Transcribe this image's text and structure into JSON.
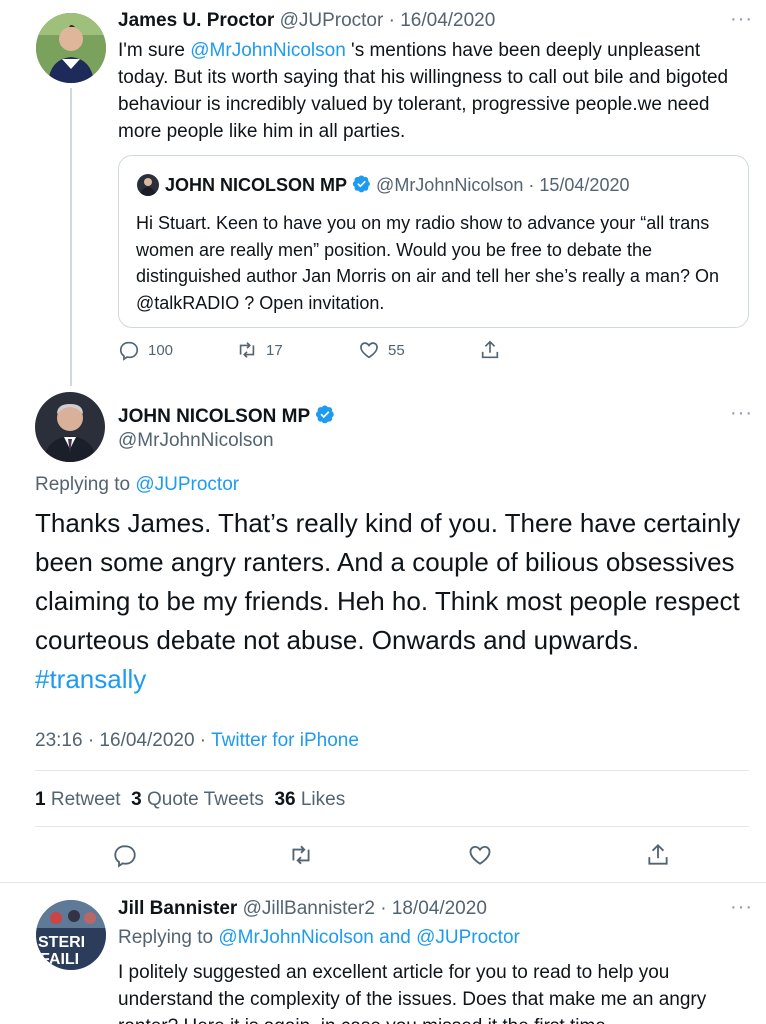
{
  "tweet1": {
    "name": "James U. Proctor",
    "handle": "@JUProctor",
    "date": "· 16/04/2020",
    "more": "···",
    "text_pre": "I'm sure ",
    "mention": "@MrJohnNicolson",
    "text_post": " 's mentions have been deeply unpleasent today. But its worth saying that his willingness to call out bile and bigoted behaviour is incredibly valued by tolerant, progressive people.we need more people like him in all parties.",
    "quote": {
      "name": "JOHN NICOLSON MP",
      "handle": "@MrJohnNicolson",
      "date": "· 15/04/2020",
      "text": "Hi Stuart. Keen to have you on my radio show to advance your “all trans women are really men” position. Would you be free to debate the distinguished author Jan Morris on air and tell her she’s really a man? On @talkRADIO ? Open invitation."
    },
    "replies": "100",
    "retweets": "17",
    "likes": "55"
  },
  "main_tweet": {
    "name": "JOHN NICOLSON MP",
    "handle": "@MrJohnNicolson",
    "more": "···",
    "replying_label": "Replying to ",
    "replying_to": "@JUProctor",
    "text": "Thanks James. That’s really kind of you. There have certainly been some angry ranters. And a couple of bilious obsessives claiming to be my friends. Heh ho. Think most people respect courteous debate not abuse. Onwards and upwards.",
    "hashtag": "#transally",
    "timestamp": "23:16 · 16/04/2020 · ",
    "source": "Twitter for iPhone",
    "stats": {
      "retweets_num": "1",
      "retweets_label": "Retweet",
      "quotes_num": "3",
      "quotes_label": "Quote Tweets",
      "likes_num": "36",
      "likes_label": "Likes"
    }
  },
  "tweet3": {
    "name": "Jill Bannister",
    "handle": "@JillBannister2",
    "date": "· 18/04/2020",
    "more": "···",
    "replying_label": "Replying to ",
    "replying_to": "@MrJohnNicolson and @JUProctor",
    "text": "I politely suggested an excellent article for you to read to help you understand the complexity of the issues. Does that make me an angry ranter? Here it is again, in case you missed it the first time.",
    "avatar_text_1": "STERI",
    "avatar_text_2": "FAILI"
  },
  "colors": {
    "link": "#1d9bf0",
    "muted": "#536471",
    "border": "#cfd9de",
    "verified": "#1d9bf0"
  }
}
